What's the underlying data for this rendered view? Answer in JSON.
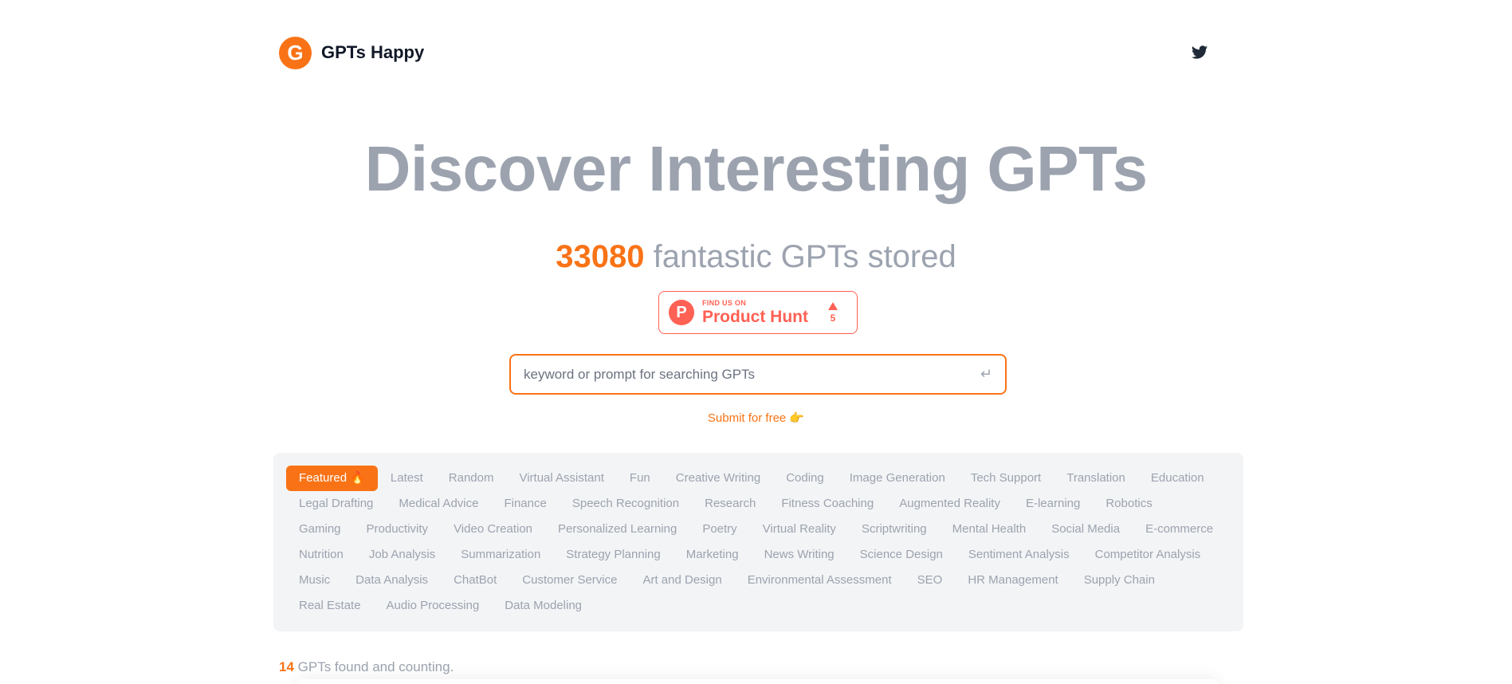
{
  "header": {
    "logo_letter": "G",
    "brand_name": "GPTs Happy",
    "twitter_icon": "twitter-icon"
  },
  "hero": {
    "title": "Discover Interesting GPTs",
    "count": "33080",
    "count_suffix": " fantastic GPTs stored"
  },
  "product_hunt": {
    "logo_letter": "P",
    "small_text": "FIND US ON",
    "big_text": "Product Hunt",
    "votes": "5"
  },
  "search": {
    "placeholder": "keyword or prompt for searching GPTs",
    "value": "",
    "enter_icon": "↵"
  },
  "submit_link": "Submit for free 👉",
  "tags": [
    "Featured 🔥",
    "Latest",
    "Random",
    "Virtual Assistant",
    "Fun",
    "Creative Writing",
    "Coding",
    "Image Generation",
    "Tech Support",
    "Translation",
    "Education",
    "Legal Drafting",
    "Medical Advice",
    "Finance",
    "Speech Recognition",
    "Research",
    "Fitness Coaching",
    "Augmented Reality",
    "E-learning",
    "Robotics",
    "Gaming",
    "Productivity",
    "Video Creation",
    "Personalized Learning",
    "Poetry",
    "Virtual Reality",
    "Scriptwriting",
    "Mental Health",
    "Social Media",
    "E-commerce",
    "Nutrition",
    "Job Analysis",
    "Summarization",
    "Strategy Planning",
    "Marketing",
    "News Writing",
    "Science Design",
    "Sentiment Analysis",
    "Competitor Analysis",
    "Music",
    "Data Analysis",
    "ChatBot",
    "Customer Service",
    "Art and Design",
    "Environmental Assessment",
    "SEO",
    "HR Management",
    "Supply Chain",
    "Real Estate",
    "Audio Processing",
    "Data Modeling"
  ],
  "active_tag_index": 0,
  "results": {
    "count": "14",
    "suffix": " GPTs found and counting."
  },
  "colors": {
    "accent": "#f97316",
    "muted": "#9ca3af",
    "product_hunt": "#ff6154",
    "panel_bg": "#f3f4f6"
  }
}
